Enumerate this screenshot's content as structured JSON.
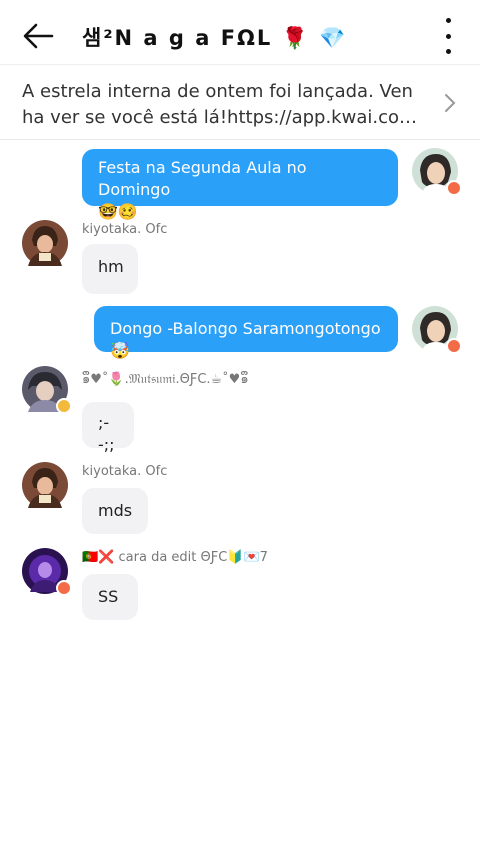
{
  "header": {
    "title": "샘²N a g a  FΩL 🌹 💎"
  },
  "notice": {
    "text": "A estrela interna de ontem foi lançada. Venha ver se você está lá!https://app.kwai.com/fam..."
  },
  "messages": [
    {
      "direction": "out",
      "text": "Festa na Segunda Aula no Domingo",
      "emoji": "🤓🥴"
    },
    {
      "direction": "in",
      "sender": "kiyotaka. Ofc",
      "text": "hm"
    },
    {
      "direction": "out",
      "text": "Dongo -Balongo Saramongotongo 🤯"
    },
    {
      "direction": "in",
      "sender": "๑ຶ♥˚🌷.𝔐𝔲𝔱𝔰𝔲𝔪𝔦.ΘƑC.☕˚♥๑ຶ",
      "text": ";--;;"
    },
    {
      "direction": "in",
      "sender": "kiyotaka. Ofc",
      "text": "mds"
    },
    {
      "direction": "in",
      "sender": "🇵🇹❌ cara da edit ΘƑC🔰💌7",
      "text": "SS"
    }
  ],
  "colors": {
    "accent": "#2aa0f8",
    "incoming_bubble": "#f2f2f4",
    "badge_orange": "#f46c47"
  }
}
